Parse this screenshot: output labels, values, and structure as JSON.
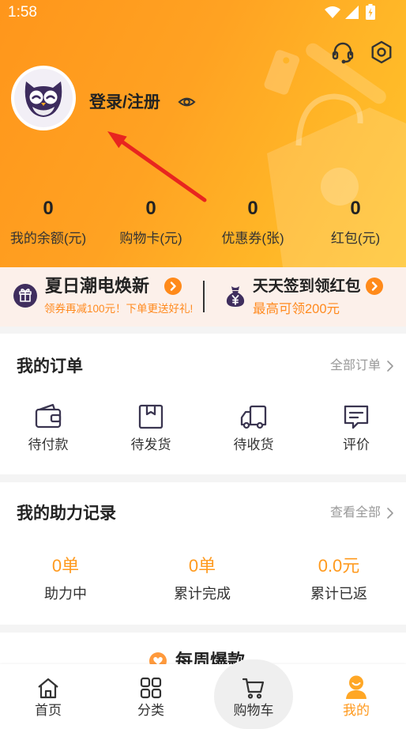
{
  "status_bar": {
    "time": "1:58"
  },
  "header": {
    "login_label": "登录/注册",
    "stats": [
      {
        "value": "0",
        "label": "我的余额(元)"
      },
      {
        "value": "0",
        "label": "购物卡(元)"
      },
      {
        "value": "0",
        "label": "优惠券(张)"
      },
      {
        "value": "0",
        "label": "红包(元)"
      }
    ],
    "icons": [
      "headset-icon",
      "settings-icon",
      "eye-icon",
      "owl-avatar-icon"
    ]
  },
  "promo": {
    "left": {
      "title": "夏日潮电焕新",
      "subtitle": "领券再减100元！下单更送好礼!",
      "icon": "gift-icon"
    },
    "right": {
      "title": "天天签到领红包",
      "subtitle": "最高可领200元",
      "icon": "money-bag-icon"
    }
  },
  "orders": {
    "title": "我的订单",
    "all_link": "全部订单",
    "items": [
      {
        "label": "待付款",
        "icon": "wallet-icon"
      },
      {
        "label": "待发货",
        "icon": "package-icon"
      },
      {
        "label": "待收货",
        "icon": "truck-icon"
      },
      {
        "label": "评价",
        "icon": "comment-icon"
      }
    ]
  },
  "assist": {
    "title": "我的助力记录",
    "all_link": "查看全部",
    "stats": [
      {
        "value": "0单",
        "label": "助力中"
      },
      {
        "value": "0单",
        "label": "累计完成"
      },
      {
        "value": "0.0元",
        "label": "累计已返"
      }
    ]
  },
  "weekly": {
    "title": "每周爆款",
    "icon": "heart-icon"
  },
  "tabbar": {
    "items": [
      {
        "label": "首页",
        "icon": "home-icon",
        "active": false
      },
      {
        "label": "分类",
        "icon": "grid-icon",
        "active": false
      },
      {
        "label": "购物车",
        "icon": "cart-icon",
        "active": false
      },
      {
        "label": "我的",
        "icon": "person-icon",
        "active": true
      }
    ]
  },
  "colors": {
    "accent": "#FF9A1E",
    "header_gradient_start": "#FF961B",
    "header_gradient_end": "#FFC42C",
    "icon_purple": "#3D2C5E",
    "annotation_arrow": "#E8251F"
  }
}
